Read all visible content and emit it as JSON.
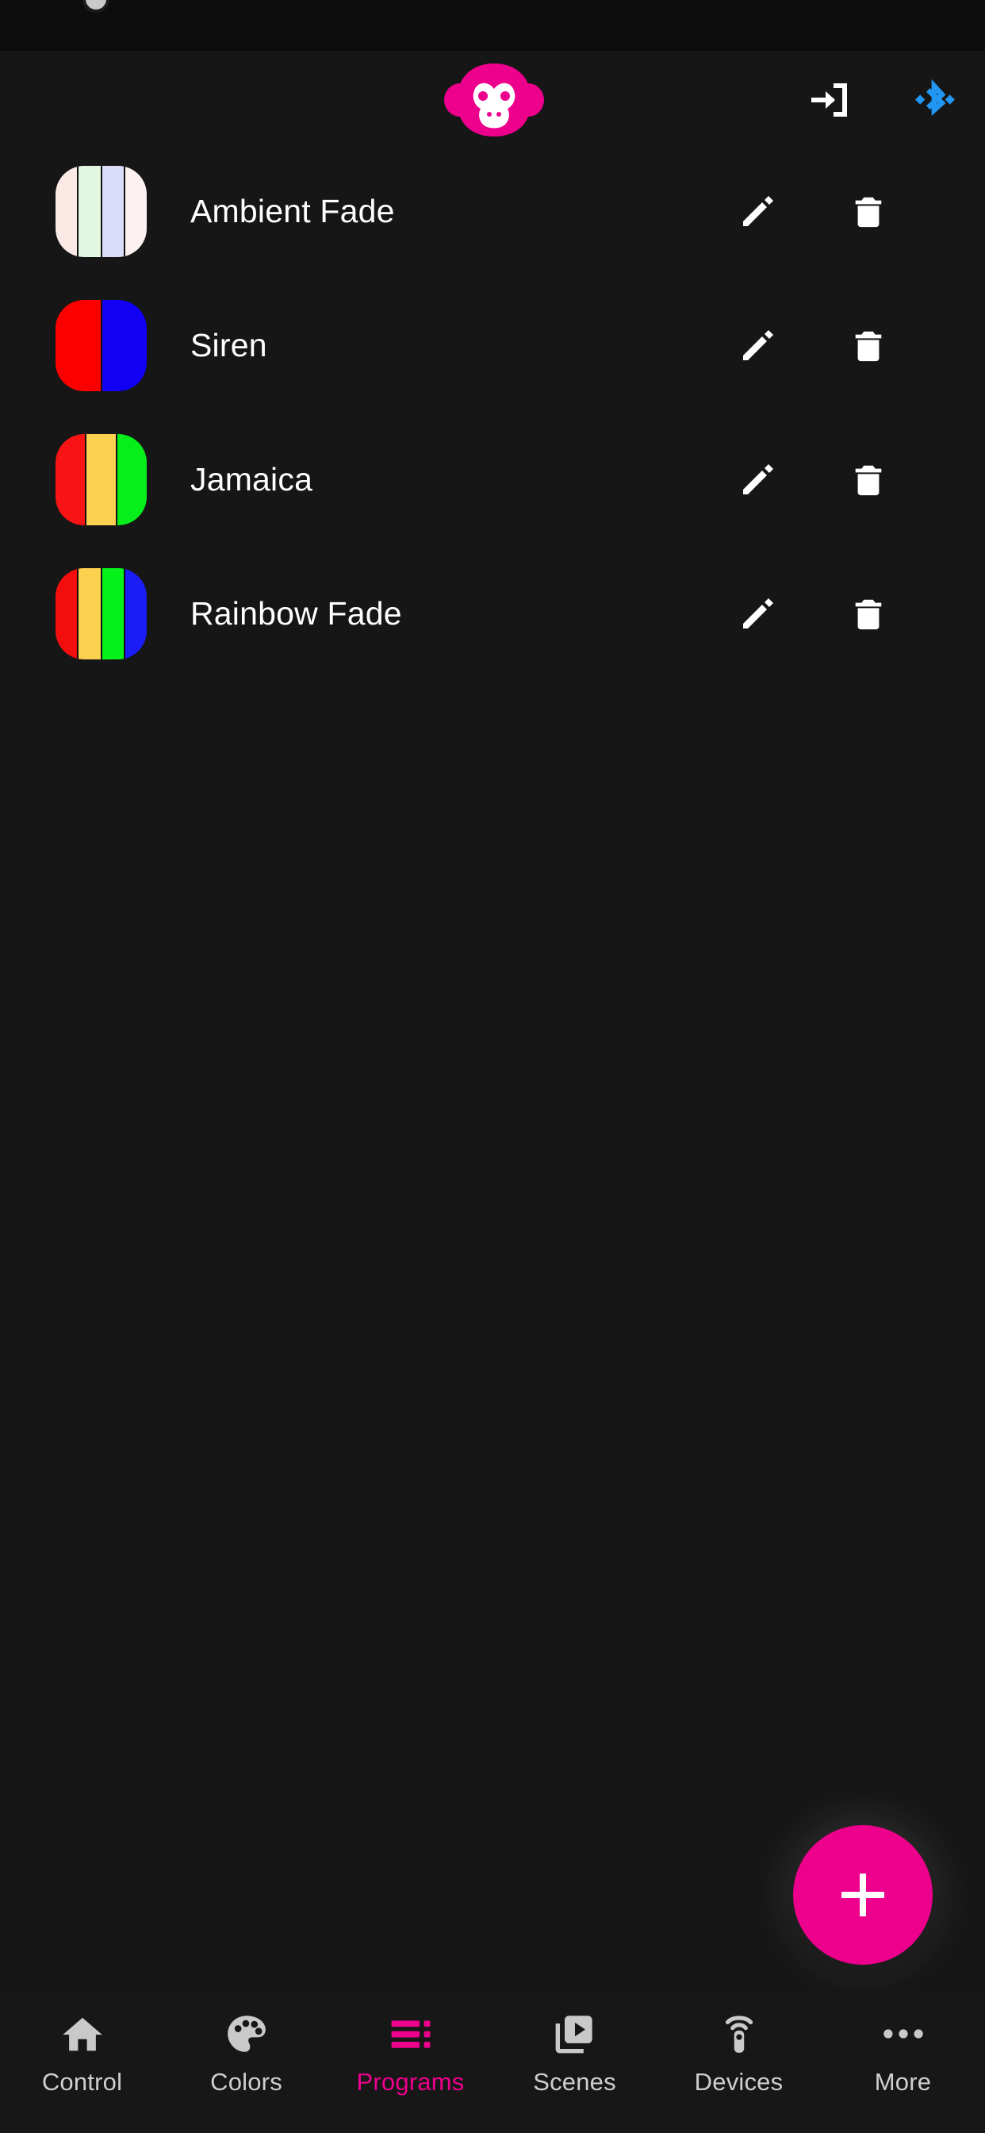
{
  "app": {
    "background": "#161616",
    "accent": "#ec008c",
    "bluetooth_color": "#2196f3"
  },
  "header": {
    "logo_icon": "monkey-logo-icon",
    "logo_color": "#ec008c",
    "login_icon": "login-arrow-icon",
    "login_label": "Login",
    "bluetooth_icon": "bluetooth-icon",
    "bluetooth_label": "Bluetooth"
  },
  "programs": [
    {
      "name": "Ambient Fade",
      "colors": [
        "#fae9e4",
        "#e2f7e0",
        "#dadcf9",
        "#fdf2f1"
      ],
      "edit_icon": "pencil-icon",
      "delete_icon": "trash-icon"
    },
    {
      "name": "Siren",
      "colors": [
        "#fc0000",
        "#1200f5"
      ],
      "edit_icon": "pencil-icon",
      "delete_icon": "trash-icon"
    },
    {
      "name": "Jamaica",
      "colors": [
        "#f81414",
        "#fbd košt",
        "#06ef1b"
      ],
      "edit_icon": "pencil-icon",
      "delete_icon": "trash-icon"
    },
    {
      "name": "Rainbow Fade",
      "colors": [
        "#f40d0d",
        "#fbd14f",
        "#04f21a",
        "#1a1df5"
      ],
      "edit_icon": "pencil-icon",
      "delete_icon": "trash-icon"
    }
  ],
  "fab": {
    "icon": "plus-icon",
    "label": "Add program",
    "color": "#ec008c"
  },
  "bottom_nav": {
    "items": [
      {
        "label": "Control",
        "icon": "home-icon",
        "active": false
      },
      {
        "label": "Colors",
        "icon": "palette-icon",
        "active": false
      },
      {
        "label": "Programs",
        "icon": "queue-list-icon",
        "active": true
      },
      {
        "label": "Scenes",
        "icon": "video-library-icon",
        "active": false
      },
      {
        "label": "Devices",
        "icon": "remote-signal-icon",
        "active": false
      },
      {
        "label": "More",
        "icon": "more-dots-icon",
        "active": false
      }
    ]
  }
}
